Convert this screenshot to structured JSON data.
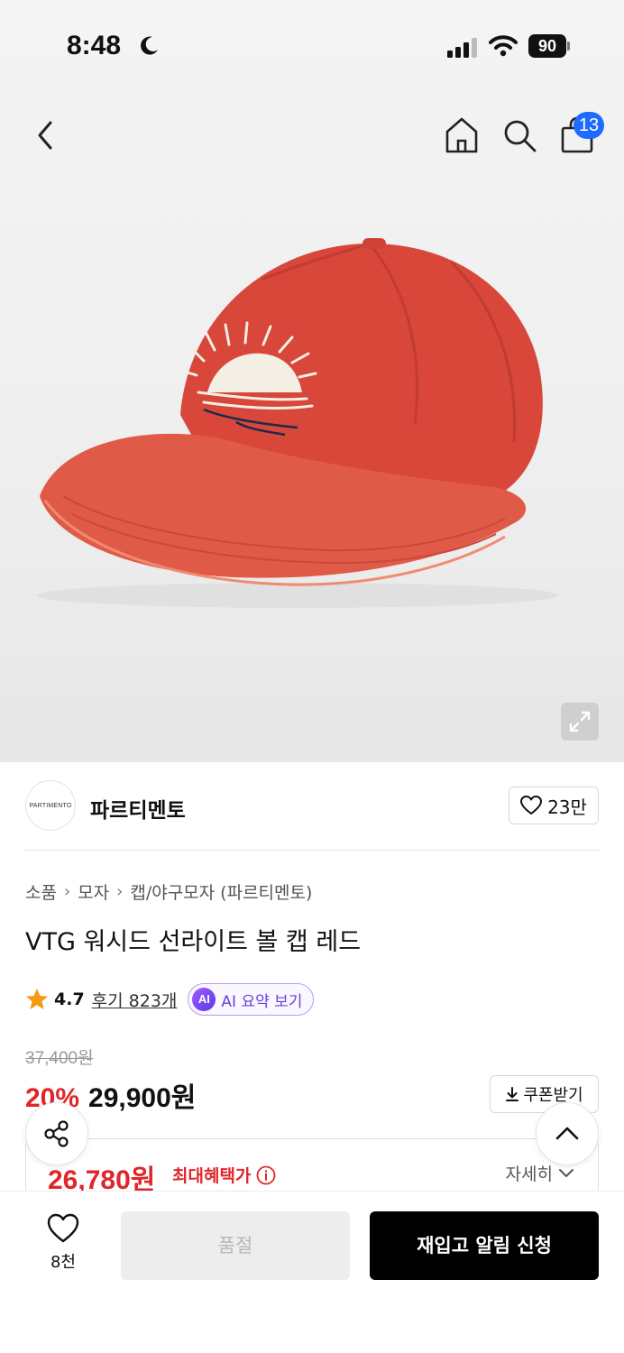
{
  "status_bar": {
    "time": "8:48",
    "battery": "90"
  },
  "nav": {
    "cart_count": "13"
  },
  "brand": {
    "logo_text": "PARTIMENTO",
    "name": "파르티멘토",
    "like_count": "23만"
  },
  "breadcrumb": [
    "소품",
    "모자",
    "캡/야구모자 (파르티멘토)"
  ],
  "product": {
    "title": "VTG 워시드 선라이트 볼 캡 레드",
    "rating": "4.7",
    "review_label": "후기 823개",
    "ai_badge": "AI",
    "ai_label": "AI 요약 보기",
    "original_price": "37,400원",
    "discount": "20%",
    "sale_price": "29,900원",
    "coupon_label": "쿠폰받기",
    "max_benefit_price": "26,780원",
    "max_benefit_label": "최대혜택가",
    "detail_label": "자세히"
  },
  "bottom_bar": {
    "wish_count": "8천",
    "soldout_label": "품절",
    "restock_label": "재입고 알림 신청"
  },
  "colors": {
    "accent_red": "#e0262b",
    "badge_blue": "#1f6bff",
    "hat_red": "#d94a3c"
  },
  "icons": [
    "back-icon",
    "home-icon",
    "search-icon",
    "bag-icon",
    "expand-icon",
    "heart-icon",
    "star-icon",
    "download-icon",
    "info-icon",
    "chevron-down-icon",
    "share-icon",
    "chevron-up-icon",
    "moon-icon",
    "signal-icon",
    "wifi-icon"
  ]
}
